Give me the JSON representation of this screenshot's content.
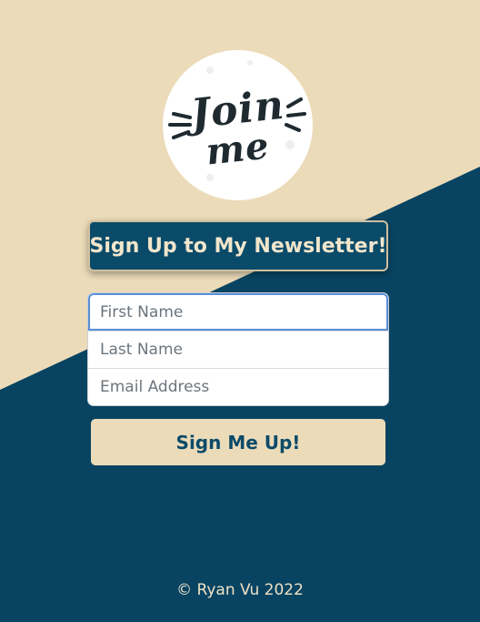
{
  "colors": {
    "navy": "#084462",
    "cream": "#ecdbb9",
    "title_text": "#f1e6cc"
  },
  "logo": {
    "line1": "Join",
    "line2": "me"
  },
  "title": "Sign Up to My Newsletter!",
  "form": {
    "first_name_placeholder": "First Name",
    "last_name_placeholder": "Last Name",
    "email_placeholder": "Email Address"
  },
  "submit_label": "Sign Me Up!",
  "footer": "© Ryan Vu 2022"
}
